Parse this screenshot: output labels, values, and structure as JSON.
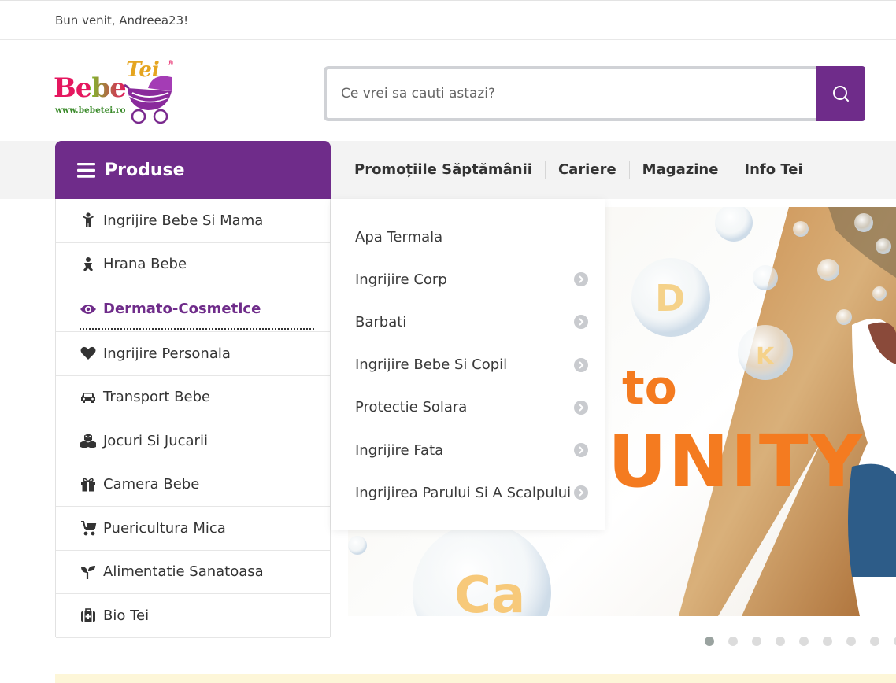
{
  "header": {
    "welcome": "Bun venit, Andreea23!"
  },
  "logo": {
    "bebe": "Bebe",
    "tei": "Tei",
    "reg": "®",
    "url": "www.bebetei.ro"
  },
  "search": {
    "placeholder": "Ce vrei sa cauti astazi?",
    "value": ""
  },
  "nav": {
    "menu_label": "Produse",
    "links": [
      "Promoțiile Săptămânii",
      "Cariere",
      "Magazine",
      "Info Tei"
    ]
  },
  "categories": [
    {
      "label": "Ingrijire Bebe Si Mama",
      "icon": "child-icon"
    },
    {
      "label": "Hrana Bebe",
      "icon": "baby-icon"
    },
    {
      "label": "Dermato-Cosmetice",
      "icon": "eye-icon",
      "active": true
    },
    {
      "label": "Ingrijire Personala",
      "icon": "heart-icon"
    },
    {
      "label": "Transport Bebe",
      "icon": "car-icon"
    },
    {
      "label": "Jocuri Si Jucarii",
      "icon": "cubes-icon"
    },
    {
      "label": "Camera Bebe",
      "icon": "gift-icon"
    },
    {
      "label": "Puericultura Mica",
      "icon": "stroller-icon"
    },
    {
      "label": "Alimentatie Sanatoasa",
      "icon": "seedling-icon"
    },
    {
      "label": "Bio Tei",
      "icon": "medkit-icon"
    }
  ],
  "submenu": [
    {
      "label": "Apa Termala",
      "has_children": false
    },
    {
      "label": "Ingrijire Corp",
      "has_children": true
    },
    {
      "label": "Barbati",
      "has_children": true
    },
    {
      "label": "Ingrijire Bebe Si Copil",
      "has_children": true
    },
    {
      "label": "Protectie Solara",
      "has_children": true
    },
    {
      "label": "Ingrijire Fata",
      "has_children": true
    },
    {
      "label": "Ingrijirea Parului Si A Scalpului",
      "has_children": true
    }
  ],
  "banner": {
    "text_to": "to",
    "text_unity": "UNITY",
    "bubble_letters": [
      "D",
      "K",
      "Ca"
    ]
  },
  "carousel": {
    "count": 9,
    "active_index": 0
  },
  "colors": {
    "brand_purple": "#6f2c8a",
    "banner_orange": "#f47b20"
  }
}
